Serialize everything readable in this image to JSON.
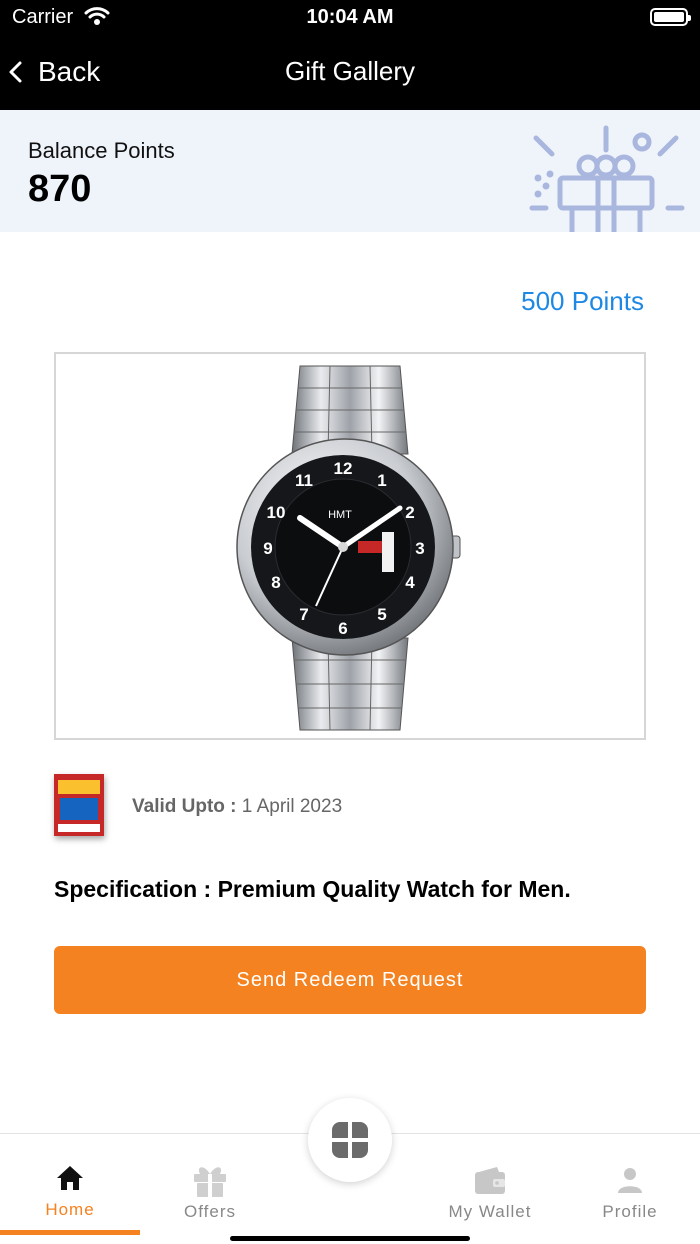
{
  "status": {
    "carrier": "Carrier",
    "time": "10:04 AM"
  },
  "header": {
    "back_label": "Back",
    "title": "Gift Gallery"
  },
  "balance": {
    "label": "Balance Points",
    "value": "870"
  },
  "gift": {
    "points": "500 Points",
    "watch_brand": "HMT",
    "valid_label": "Valid Upto :",
    "valid_date": "1 April 2023",
    "specification": "Specification : Premium Quality Watch for Men.",
    "redeem_label": "Send Redeem Request"
  },
  "tabs": [
    {
      "label": "Home",
      "icon": "home-icon",
      "active": true
    },
    {
      "label": "Offers",
      "icon": "gift-icon",
      "active": false
    },
    {
      "label": "My Wallet",
      "icon": "wallet-icon",
      "active": false
    },
    {
      "label": "Profile",
      "icon": "user-icon",
      "active": false
    }
  ],
  "colors": {
    "accent": "#f58220",
    "link": "#1e88e5",
    "banner": "#eff4fb",
    "header": "#000000"
  }
}
